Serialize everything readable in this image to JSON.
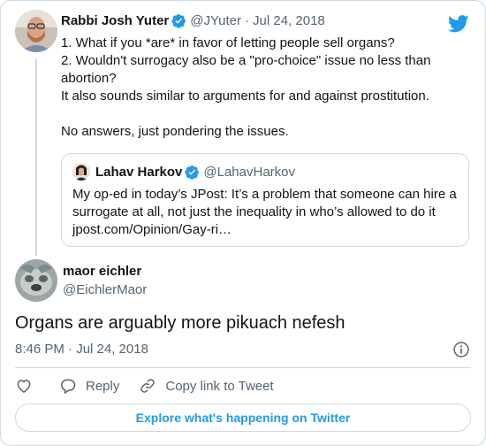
{
  "brand": {
    "logo_icon": "twitter-bird-icon",
    "accent": "#1d9bf0"
  },
  "parent_tweet": {
    "author_name": "Rabbi Josh Yuter",
    "verified_icon": "verified-badge-icon",
    "handle": "@JYuter",
    "separator": "·",
    "date": "Jul 24, 2018",
    "text": "1. What if you *are* in favor of letting people sell organs?\n2. Wouldn't surrogacy also be a \"pro-choice\" issue no less than abortion?\nIt also sounds similar to arguments for and against prostitution.\n\nNo answers, just pondering the issues."
  },
  "quoted_tweet": {
    "author_name": "Lahav Harkov",
    "verified_icon": "verified-badge-icon",
    "handle": "@LahavHarkov",
    "text_line1": "My op-ed in today’s JPost: It’s a problem that someone can hire a",
    "text_line2": "surrogate at all, not just the inequality in who’s allowed to do it",
    "link": "jpost.com/Opinion/Gay-ri…"
  },
  "reply_tweet": {
    "author_name": "maor eichler",
    "handle": "@EichlerMaor",
    "text": "Organs are arguably more pikuach nefesh",
    "timestamp": "8:46 PM · Jul 24, 2018",
    "info_icon": "info-icon"
  },
  "actions": {
    "like_icon": "heart-icon",
    "reply_icon": "reply-bubble-icon",
    "reply_label": "Reply",
    "copy_icon": "link-icon",
    "copy_label": "Copy link to Tweet"
  },
  "explore_button": {
    "label": "Explore what's happening on Twitter"
  }
}
